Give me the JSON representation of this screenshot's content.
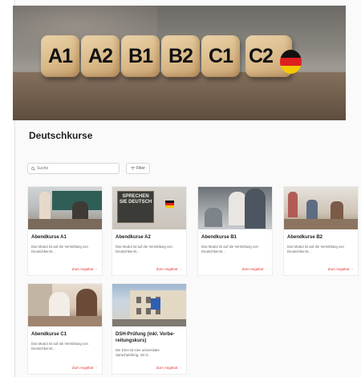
{
  "hero": {
    "dice": [
      "A1",
      "A2",
      "B1",
      "B2",
      "C1",
      "C2"
    ]
  },
  "page": {
    "title": "Deutschkurse"
  },
  "toolbar": {
    "search_placeholder": "Suche",
    "filter_label": "Filter"
  },
  "courses": [
    {
      "title": "Abendkurse A1",
      "desc": "Das Modul ist auf die Vermittlung von Deutschkennt...",
      "link": "Zum Angebot"
    },
    {
      "title": "Abendkurse A2",
      "desc": "Das Modul ist auf die Vermittlung von Deutschkennt...",
      "link": "Zum Angebot"
    },
    {
      "title": "Abendkurse B1",
      "desc": "Das Modul ist auf die Vermittlung von Deutschkennt...",
      "link": "Zum Angebot"
    },
    {
      "title": "Abendkurse B2",
      "desc": "Das Modul ist auf die Vermittlung von Deutschkennt...",
      "link": "Zum Angebot"
    },
    {
      "title": "Abendkurse C1",
      "desc": "Das Modul ist auf die Vermittlung von Deutschkennt...",
      "link": "Zum Angebot"
    },
    {
      "title": "DSH-Prüfung (inkl. Vorbe-reitungskurs)",
      "desc": "Die DSH ist eine universitäre Sprachprüfung, mit d...",
      "link": "Zum Angebot"
    }
  ],
  "images": {
    "a2_sign": "SPRECHEN SIE DEUTSCH"
  },
  "colors": {
    "link": "#e0312b",
    "flag": [
      "#111111",
      "#dd1f1f",
      "#f6c800"
    ]
  }
}
